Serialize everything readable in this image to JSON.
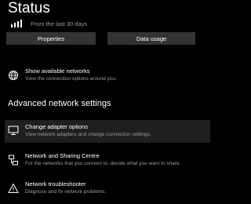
{
  "status": {
    "title": "Status",
    "subtitle": "From the last 30 days"
  },
  "buttons": {
    "properties": "Properties",
    "data_usage": "Data usage"
  },
  "networks": {
    "title": "Show available networks",
    "desc": "View the connection options around you."
  },
  "advanced": {
    "header": "Advanced network settings",
    "items": [
      {
        "icon": "network-adapter-icon",
        "title": "Change adapter options",
        "desc": "View network adapters and change connection settings."
      },
      {
        "icon": "network-sharing-icon",
        "title": "Network and Sharing Centre",
        "desc": "For the networks that you connect to, decide what you want to share."
      },
      {
        "icon": "warning-icon",
        "title": "Network troubleshooter",
        "desc": "Diagnose and fix network problems."
      }
    ]
  },
  "colors": {
    "background": "#000000",
    "button": "#333333",
    "muted_text": "#9a9a9a",
    "hover_bg": "#1f1f1f"
  }
}
